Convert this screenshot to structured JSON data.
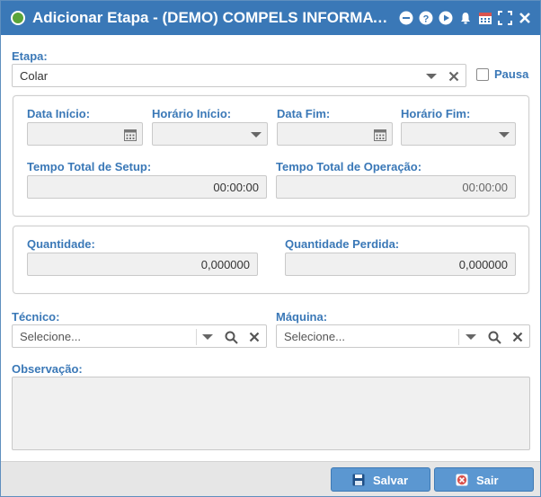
{
  "window": {
    "title": "Adicionar Etapa - (DEMO) COMPELS INFORMATIC...",
    "accent": "#3a78b7"
  },
  "etapa": {
    "label": "Etapa:",
    "value": "Colar"
  },
  "pausa": {
    "label": "Pausa",
    "checked": false
  },
  "times": {
    "data_inicio": {
      "label": "Data Início:",
      "value": ""
    },
    "horario_inicio": {
      "label": "Horário Início:",
      "value": ""
    },
    "data_fim": {
      "label": "Data Fim:",
      "value": ""
    },
    "horario_fim": {
      "label": "Horário Fim:",
      "value": ""
    },
    "setup": {
      "label": "Tempo Total de Setup:",
      "value": "00:00:00"
    },
    "operacao": {
      "label": "Tempo Total de Operação:",
      "value": "00:00:00"
    }
  },
  "quantities": {
    "quantidade": {
      "label": "Quantidade:",
      "value": "0,000000"
    },
    "perdida": {
      "label": "Quantidade Perdida:",
      "value": "0,000000"
    }
  },
  "tecnico": {
    "label": "Técnico:",
    "placeholder": "Selecione..."
  },
  "maquina": {
    "label": "Máquina:",
    "placeholder": "Selecione..."
  },
  "observacao": {
    "label": "Observação:",
    "value": ""
  },
  "footer": {
    "save_label": "Salvar",
    "exit_label": "Sair"
  },
  "icons": {
    "title": "plus-circle-icon",
    "toolbar": [
      "minus-circle-icon",
      "help-icon",
      "play-icon",
      "bell-icon",
      "calendar-icon",
      "fullscreen-icon",
      "close-icon"
    ]
  }
}
